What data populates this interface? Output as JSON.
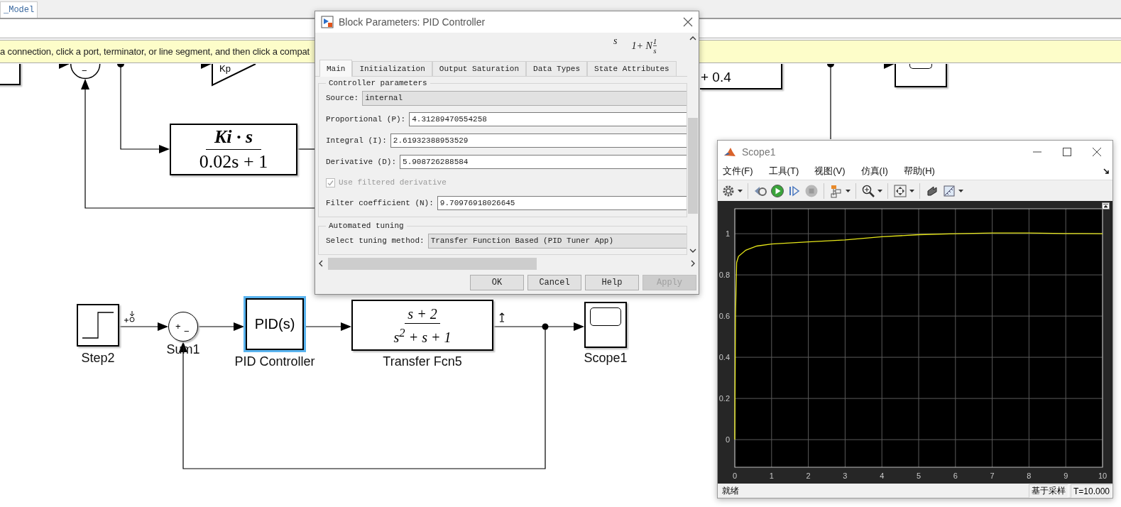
{
  "editor": {
    "tab": "_Model",
    "banner": "a connection, click a port, terminator, or line segment, and then click a compat"
  },
  "upper_blocks": [
    {
      "kind": "block",
      "selected": false
    },
    {
      "kind": "sum",
      "selected": false,
      "signs": [
        "−"
      ]
    },
    {
      "kind": "gain",
      "selected": false,
      "text": "Kp"
    },
    {
      "kind": "transfer_fcn",
      "selected": false,
      "numerator": "Ki · s",
      "denominator": "0.02s + 1"
    },
    {
      "kind": "expression",
      "selected": false,
      "text": "+ 0.4"
    },
    {
      "kind": "scope",
      "selected": false
    }
  ],
  "blocks": [
    {
      "kind": "step",
      "selected": false,
      "label": "Step2"
    },
    {
      "kind": "sum",
      "selected": false,
      "label": "Sum1",
      "signs": [
        "+",
        "−"
      ]
    },
    {
      "kind": "pid",
      "selected": true,
      "label": "PID Controller",
      "text": "PID(s)"
    },
    {
      "kind": "transfer_fcn",
      "selected": false,
      "label": "Transfer Fcn5",
      "numerator": "s + 2",
      "denominator": "s$^{2}$ + s + 1"
    },
    {
      "kind": "scope",
      "selected": false,
      "label": "Scope1"
    }
  ],
  "dialog": {
    "title": "Block Parameters: PID Controller",
    "formula": {
      "left": "s",
      "right": "1+ N",
      "numerator": "1",
      "denominator": "s"
    },
    "tabs": [
      {
        "label": "Main",
        "selected": true
      },
      {
        "label": "Initialization",
        "selected": false
      },
      {
        "label": "Output Saturation",
        "selected": false
      },
      {
        "label": "Data Types",
        "selected": false
      },
      {
        "label": "State Attributes",
        "selected": false
      }
    ],
    "groups": [
      {
        "title": "Controller parameters",
        "rows": [
          {
            "kind": "combo",
            "label": "Source:",
            "value": "internal"
          },
          {
            "kind": "field",
            "label": "Proportional (P):",
            "value": "4.31289470554258"
          },
          {
            "kind": "field",
            "label": "Integral (I):",
            "value": "2.61932388953529"
          },
          {
            "kind": "field",
            "label": "Derivative (D):",
            "value": "5.908726288584"
          },
          {
            "kind": "checkbox",
            "label": "Use filtered derivative",
            "checked": true,
            "disabled": true
          },
          {
            "kind": "field",
            "label": "Filter coefficient (N):",
            "value": "9.70976918026645"
          }
        ]
      },
      {
        "title": "Automated tuning",
        "rows": [
          {
            "kind": "combo",
            "label": "Select tuning method:",
            "value": "Transfer Function Based (PID Tuner App)"
          }
        ]
      }
    ],
    "buttons": [
      {
        "label": "OK",
        "disabled": false
      },
      {
        "label": "Cancel",
        "disabled": false
      },
      {
        "label": "Help",
        "disabled": false
      },
      {
        "label": "Apply",
        "disabled": true
      }
    ]
  },
  "scope": {
    "title": "Scope1",
    "menu": [
      "文件(F)",
      "工具(T)",
      "视图(V)",
      "仿真(I)",
      "帮助(H)"
    ],
    "chart_data": {
      "type": "line",
      "x": [
        0,
        0.02,
        0.05,
        0.1,
        0.3,
        0.6,
        1,
        2,
        3,
        4,
        5,
        6,
        7,
        8,
        9,
        10
      ],
      "series": [
        {
          "color": "#e6e619",
          "values": [
            0,
            0.6,
            0.86,
            0.89,
            0.92,
            0.94,
            0.95,
            0.96,
            0.97,
            0.985,
            0.995,
            1.0,
            1.003,
            1.003,
            1.001,
            1.0
          ]
        }
      ],
      "grid": true,
      "xlim": [
        0,
        10
      ],
      "ylim": [
        -0.134,
        1.121
      ],
      "xticks": [
        0,
        1,
        2,
        3,
        4,
        5,
        6,
        7,
        8,
        9,
        10
      ],
      "yticks": [
        0,
        0.2,
        0.4,
        0.6,
        0.8,
        1
      ]
    },
    "status": {
      "text": "就绪",
      "mode": "基于采样",
      "time": "T=10.000"
    }
  }
}
